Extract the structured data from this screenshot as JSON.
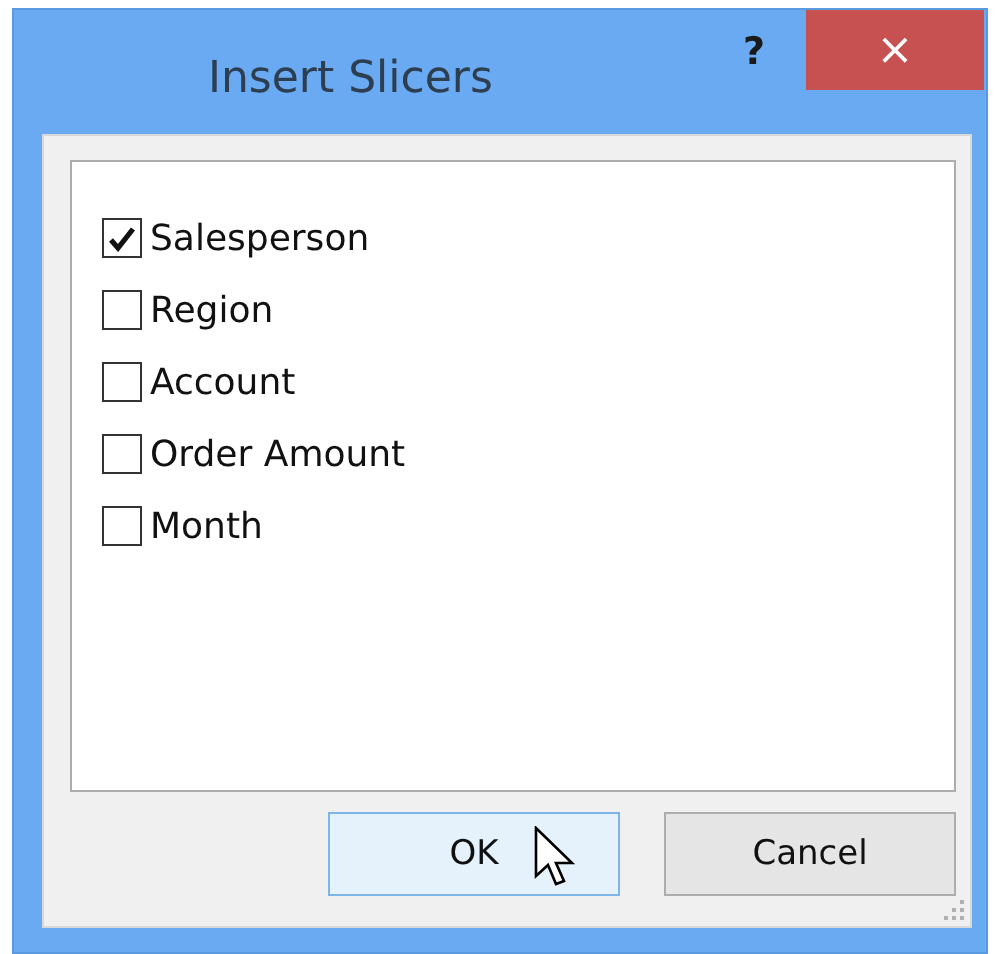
{
  "window": {
    "title": "Insert Slicers",
    "help": "?",
    "close": "×"
  },
  "fields": [
    {
      "label": "Salesperson",
      "checked": true
    },
    {
      "label": "Region",
      "checked": false
    },
    {
      "label": "Account",
      "checked": false
    },
    {
      "label": "Order Amount",
      "checked": false
    },
    {
      "label": "Month",
      "checked": false
    }
  ],
  "buttons": [
    {
      "label": "OK",
      "hovered": true
    },
    {
      "label": "Cancel",
      "hovered": false
    }
  ]
}
